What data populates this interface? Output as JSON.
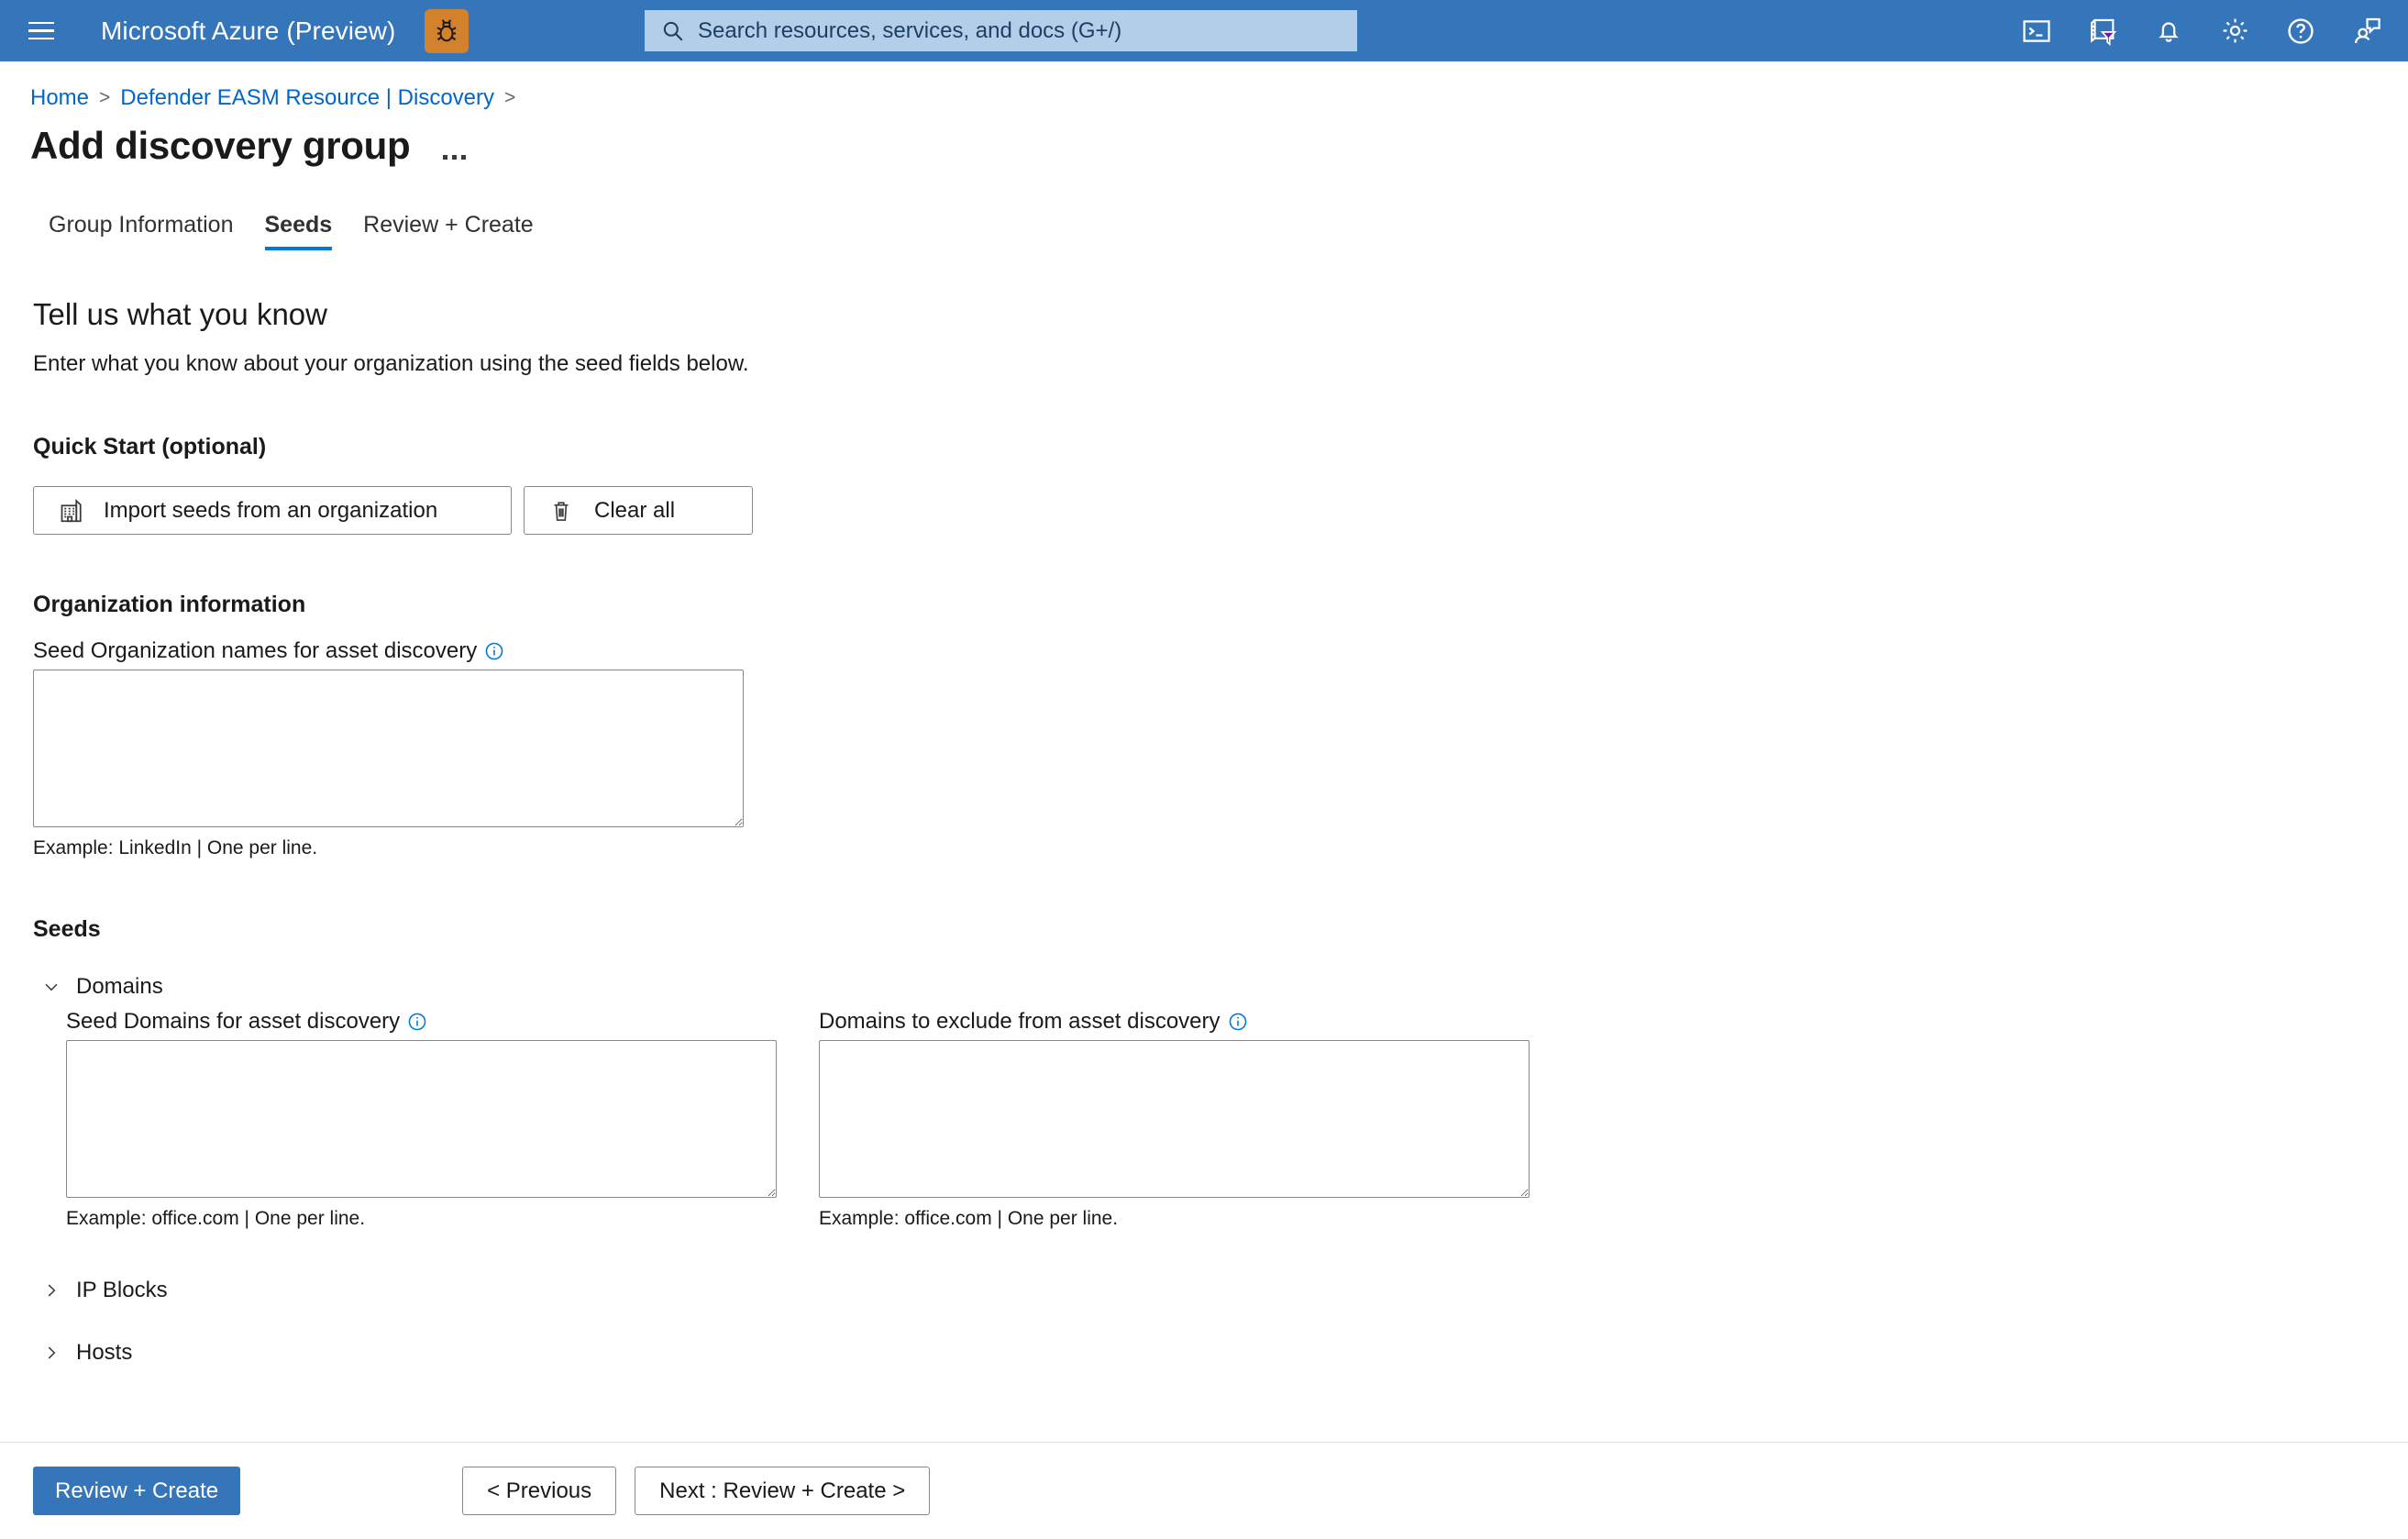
{
  "colors": {
    "azure_header_blue": "#3576ba",
    "link_blue": "#0066cc",
    "accent_blue": "#0078d4",
    "primary_button_blue": "#3576ba",
    "bug_badge_orange": "#d2812c",
    "search_field_blue": "#b3cee8",
    "filter_funnel_purple": "#7719aa",
    "border_gray": "#8a8886"
  },
  "header": {
    "menu_icon": "hamburger-menu-icon",
    "brand": "Microsoft Azure (Preview)",
    "bug_badge_icon": "bug-icon",
    "search": {
      "icon": "search-icon",
      "placeholder": "Search resources, services, and docs (G+/)",
      "value": ""
    },
    "icons": [
      {
        "name": "cloud-shell-icon",
        "label": "Cloud Shell"
      },
      {
        "name": "directory-subscription-filter-icon",
        "label": "Directories + subscriptions"
      },
      {
        "name": "notifications-bell-icon",
        "label": "Notifications"
      },
      {
        "name": "settings-gear-icon",
        "label": "Settings"
      },
      {
        "name": "help-question-icon",
        "label": "Help"
      },
      {
        "name": "feedback-person-icon",
        "label": "Feedback"
      }
    ]
  },
  "breadcrumb": {
    "items": [
      {
        "label": "Home"
      },
      {
        "label": "Defender EASM Resource | Discovery"
      }
    ],
    "separator": ">"
  },
  "page": {
    "title": "Add discovery group",
    "more_menu": "..."
  },
  "tabs": [
    {
      "label": "Group Information",
      "active": false
    },
    {
      "label": "Seeds",
      "active": true
    },
    {
      "label": "Review + Create",
      "active": false
    }
  ],
  "main": {
    "heading": "Tell us what you know",
    "description": "Enter what you know about your organization using the seed fields below.",
    "quick_start": {
      "title": "Quick Start (optional)",
      "import_button": {
        "label": "Import seeds from an organization",
        "icon": "office-building-icon"
      },
      "clear_button": {
        "label": "Clear all",
        "icon": "trash-delete-icon"
      }
    },
    "organization_information": {
      "title": "Organization information",
      "field": {
        "label": "Seed Organization names for asset discovery",
        "info_icon": "info-circle-icon",
        "value": "",
        "hint": "Example: LinkedIn | One per line."
      }
    },
    "seeds": {
      "title": "Seeds",
      "sections": [
        {
          "label": "Domains",
          "expanded": true,
          "chevron_icon": "chevron-down-icon",
          "fields": [
            {
              "label": "Seed Domains for asset discovery",
              "info_icon": "info-circle-icon",
              "value": "",
              "hint": "Example: office.com | One per line."
            },
            {
              "label": "Domains to exclude from asset discovery",
              "info_icon": "info-circle-icon",
              "value": "",
              "hint": "Example: office.com | One per line."
            }
          ]
        },
        {
          "label": "IP Blocks",
          "expanded": false,
          "chevron_icon": "chevron-right-icon",
          "fields": []
        },
        {
          "label": "Hosts",
          "expanded": false,
          "chevron_icon": "chevron-right-icon",
          "fields": []
        }
      ]
    }
  },
  "footer": {
    "primary_button": "Review + Create",
    "previous_button": "< Previous",
    "next_button": "Next : Review + Create >"
  }
}
